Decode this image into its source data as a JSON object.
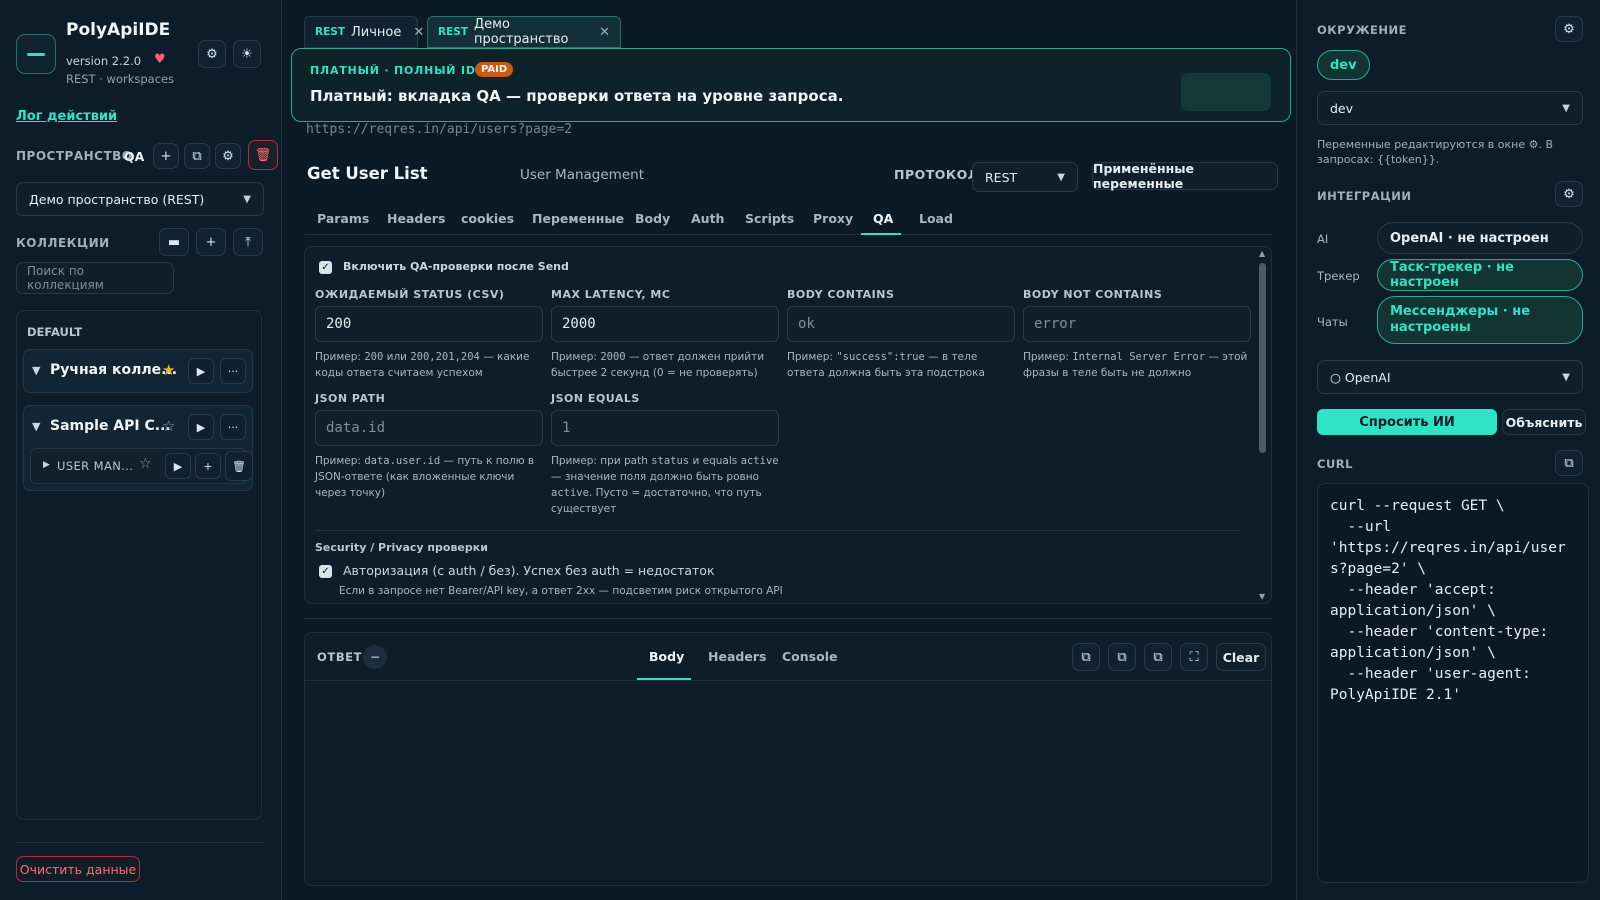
{
  "app": {
    "name": "PolyApiIDE",
    "version": "version 2.2.0",
    "subtitle": "REST · workspaces"
  },
  "left": {
    "log_link": "Лог действий",
    "space_label": "ПРОСТРАНСТВО",
    "space_code": "QA",
    "space_select": "Демо пространство (REST)",
    "collections_label": "КОЛЛЕКЦИИ",
    "search_placeholder": "Поиск по коллекциям",
    "default_label": "DEFAULT",
    "collections": [
      {
        "name": "Ручная колле...",
        "starred": true
      },
      {
        "name": "Sample API C...",
        "starred": false,
        "children": [
          {
            "name": "USER MAN..."
          }
        ]
      }
    ],
    "clear_data": "Очистить данные"
  },
  "tabs": [
    {
      "kind": "REST",
      "label": "Личное"
    },
    {
      "kind": "REST",
      "label": "Демо пространство",
      "active": true
    }
  ],
  "banner": {
    "kicker": "ПЛАТНЫЙ · ПОЛНЫЙ IDE",
    "badge": "PAID",
    "message": "Платный: вкладка QA — проверки ответа на уровне запроса."
  },
  "request": {
    "url": "https://reqres.in/api/users?page=2",
    "title": "Get User List",
    "group": "User Management",
    "protocol_label": "ПРОТОКОЛ",
    "protocol": "REST",
    "applied_vars": "Применённые переменные",
    "subtabs": [
      "Params",
      "Headers",
      "cookies",
      "Переменные",
      "Body",
      "Auth",
      "Scripts",
      "Proxy",
      "QA",
      "Load"
    ],
    "active_subtab": "QA"
  },
  "qa": {
    "enable_label": "Включить QA-проверки после Send",
    "status_label": "ОЖИДАЕМЫЙ STATUS (CSV)",
    "status_value": "200",
    "status_help_pre": "Пример: ",
    "status_help_code": "200",
    "status_help_mid": " или ",
    "status_help_code2": "200,201,204",
    "status_help_post": " — какие коды ответа считаем успехом",
    "latency_label": "MAX LATENCY, МС",
    "latency_value": "2000",
    "latency_help_pre": "Пример: ",
    "latency_help_code": "2000",
    "latency_help_post": " — ответ должен прийти быстрее 2 секунд (0 = не проверять)",
    "contains_label": "BODY CONTAINS",
    "contains_placeholder": "ok",
    "contains_help_pre": "Пример: ",
    "contains_help_code": "\"success\":true",
    "contains_help_post": " — в теле ответа должна быть эта подстрока",
    "not_contains_label": "BODY NOT CONTAINS",
    "not_contains_placeholder": "error",
    "not_contains_help_pre": "Пример: ",
    "not_contains_help_code": "Internal Server Error",
    "not_contains_help_post": " — этой фразы в теле быть не должно",
    "json_path_label": "JSON PATH",
    "json_path_placeholder": "data.id",
    "json_path_help_pre": "Пример: ",
    "json_path_help_code": "data.user.id",
    "json_path_help_post": " — путь к полю в JSON-ответе (как вложенные ключи через точку)",
    "json_equals_label": "JSON EQUALS",
    "json_equals_placeholder": "1",
    "json_equals_help_pre": "Пример: при path ",
    "json_equals_help_code": "status",
    "json_equals_help_mid": " и equals ",
    "json_equals_help_code2": "active",
    "json_equals_help_mid2": " — значение поля должно быть ровно ",
    "json_equals_help_code3": "active",
    "json_equals_help_post": ". Пусто = достаточно, что путь существует",
    "security_title": "Security / Privacy проверки",
    "auth_check_label": "Авторизация (с auth / без). Успех без auth = недостаток",
    "auth_check_help": "Если в запросе нет Bearer/API key, а ответ 2xx — подсветим риск открытого API"
  },
  "response": {
    "label": "ОТВЕТ",
    "tabs": [
      "Body",
      "Headers",
      "Console"
    ],
    "active_tab": "Body",
    "clear": "Clear"
  },
  "right": {
    "env_label": "ОКРУЖЕНИЕ",
    "env_pill": "dev",
    "env_select": "dev",
    "env_note": "Переменные редактируются в окне ⚙. В запросах: {{token}}.",
    "integrations_label": "ИНТЕГРАЦИИ",
    "integrations": [
      {
        "label": "AI",
        "value": "OpenAI · не настроен"
      },
      {
        "label": "Трекер",
        "value": "Таск-трекер · не настроен"
      },
      {
        "label": "Чаты",
        "value": "Мессенджеры · не настроены"
      }
    ],
    "ai_select": "○ OpenAI",
    "ask_ai": "Спросить ИИ",
    "explain": "Объяснить",
    "curl_label": "CURL",
    "curl_text": "curl --request GET \\\n  --url\n'https://reqres.in/api/users?page=2' \\\n  --header 'accept:\napplication/json' \\\n  --header 'content-type:\napplication/json' \\\n  --header 'user-agent:\nPolyApiIDE 2.1'"
  },
  "colors": {
    "accent": "#2ee3c6",
    "danger": "#ff6b78",
    "bg": "#0c1a26",
    "paid": "#c75b1a"
  }
}
